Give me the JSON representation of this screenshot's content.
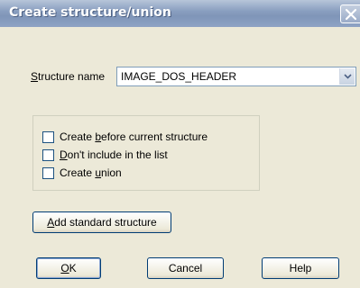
{
  "window": {
    "title": "Create structure/union"
  },
  "structure_name": {
    "label_prefix": "",
    "label_accel": "S",
    "label_rest": "tructure name",
    "value": "IMAGE_DOS_HEADER"
  },
  "options": [
    {
      "pre": "Create ",
      "accel": "b",
      "post": "efore current structure",
      "checked": false
    },
    {
      "pre": "",
      "accel": "D",
      "post": "on't include in the list",
      "checked": false
    },
    {
      "pre": "Create ",
      "accel": "u",
      "post": "nion",
      "checked": false
    }
  ],
  "buttons": {
    "add_standard": {
      "accel": "A",
      "rest": "dd standard structure"
    },
    "ok": {
      "accel": "O",
      "rest": "K"
    },
    "cancel": "Cancel",
    "help": "Help"
  },
  "icons": {
    "close": "close-icon",
    "dropdown": "chevron-down-icon"
  }
}
